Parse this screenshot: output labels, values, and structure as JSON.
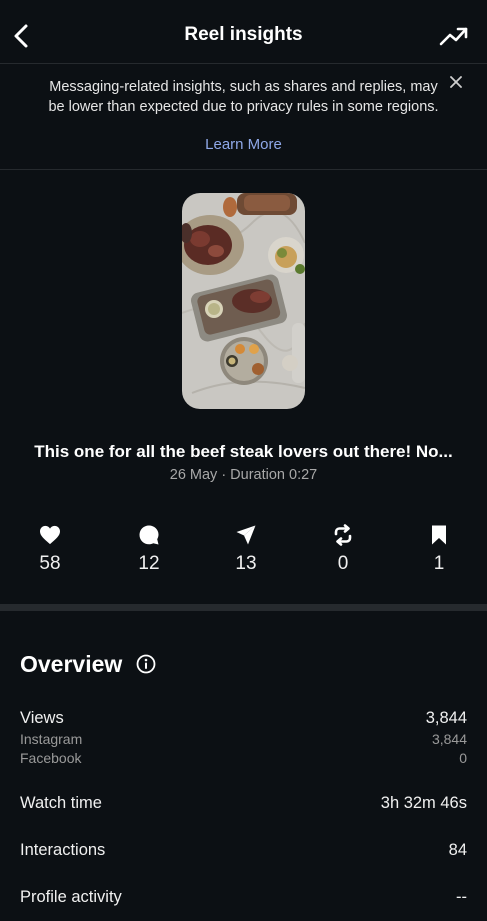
{
  "header": {
    "title": "Reel insights",
    "back_icon": "chevron-left-icon",
    "trend_icon": "trending-up-icon"
  },
  "notice": {
    "text": "Messaging-related insights, such as shares and replies, may be lower than expected due to privacy rules in some regions.",
    "link": "Learn More",
    "close_icon": "close-icon"
  },
  "reel": {
    "caption": "This one for all the beef steak lovers out there! No...",
    "meta": "26 May · Duration 0:27"
  },
  "stats": [
    {
      "icon": "heart-icon",
      "value": "58"
    },
    {
      "icon": "comment-icon",
      "value": "12"
    },
    {
      "icon": "share-icon",
      "value": "13"
    },
    {
      "icon": "repost-icon",
      "value": "0"
    },
    {
      "icon": "bookmark-icon",
      "value": "1"
    }
  ],
  "overview": {
    "title": "Overview",
    "info_icon": "info-icon",
    "views_label": "Views",
    "views_value": "3,844",
    "instagram_label": "Instagram",
    "instagram_value": "3,844",
    "facebook_label": "Facebook",
    "facebook_value": "0",
    "watch_time_label": "Watch time",
    "watch_time_value": "3h 32m 46s",
    "interactions_label": "Interactions",
    "interactions_value": "84",
    "profile_activity_label": "Profile activity",
    "profile_activity_value": "--"
  },
  "colors": {
    "background": "#0c1014",
    "link": "#8fa8e8",
    "divider": "#262a2e"
  }
}
